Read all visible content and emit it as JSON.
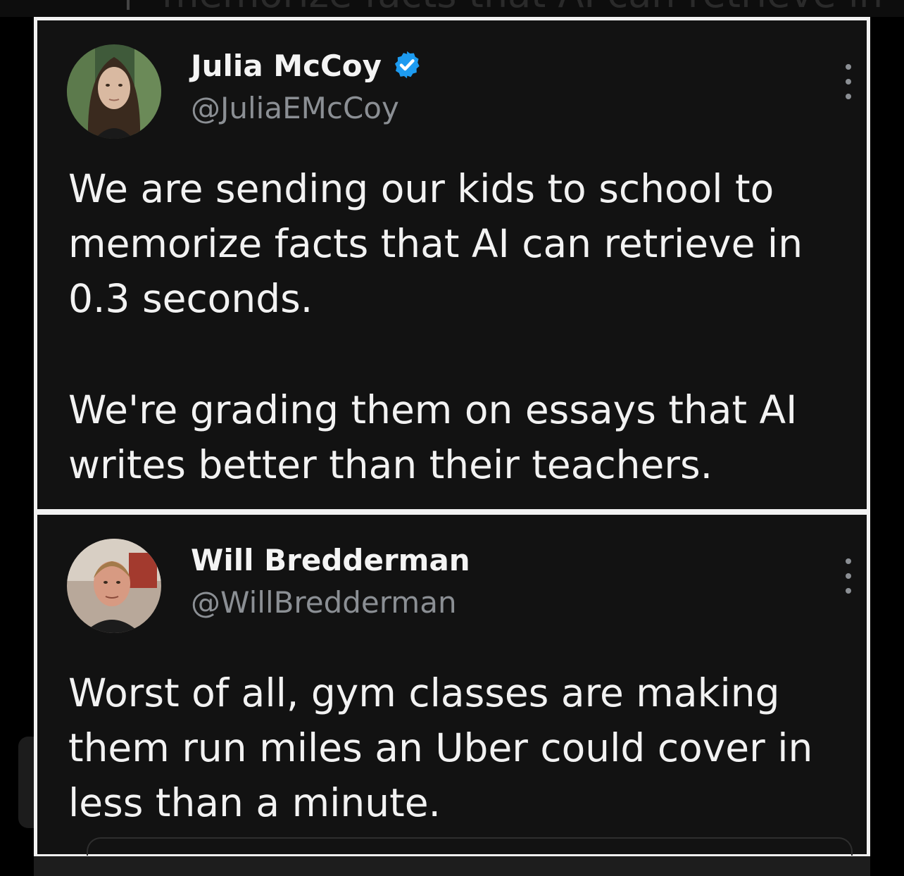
{
  "background_text": "memorize facts that AI can retrieve in",
  "colors": {
    "background": "#000000",
    "card": "#121212",
    "card_border": "#f2f2f2",
    "text": "#f2f2f2",
    "muted": "#8b8f94",
    "verified": "#1d9bf0"
  },
  "tweets": [
    {
      "display_name": "Julia McCoy",
      "handle": "@JuliaEMcCoy",
      "verified": true,
      "paragraphs": [
        "We are sending our kids to school to memorize facts that AI can retrieve in 0.3 seconds.",
        "We're grading them on essays that AI writes better than their teachers."
      ]
    },
    {
      "display_name": "Will Bredderman",
      "handle": "@WillBredderman",
      "verified": false,
      "paragraphs": [
        "Worst of all, gym classes are making them run miles an Uber could cover in less than a minute."
      ]
    }
  ],
  "icons": {
    "verified": "verified-badge-icon",
    "more": "more-vertical-icon"
  }
}
